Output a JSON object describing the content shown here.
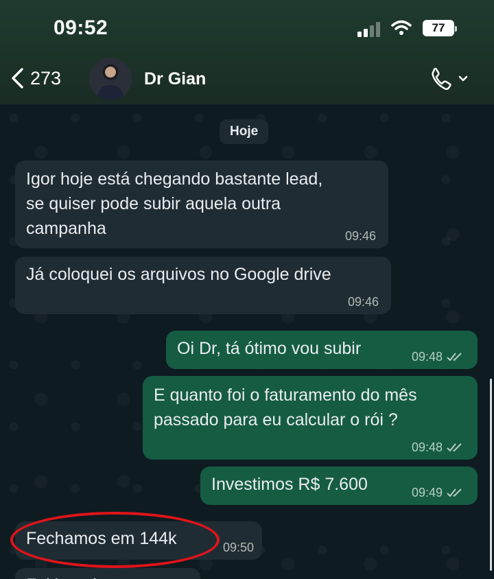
{
  "status_bar": {
    "time": "09:52",
    "battery": "77"
  },
  "header": {
    "back_count": "273",
    "contact_name": "Dr Gian"
  },
  "chat": {
    "day_label": "Hoje",
    "messages": [
      {
        "direction": "in",
        "text": "Igor hoje está chegando bastante lead, se quiser pode subir aquela outra campanha",
        "lines": [
          "Igor hoje está chegando bastante lead,",
          "se quiser pode subir aquela outra",
          "campanha"
        ],
        "time": "09:46"
      },
      {
        "direction": "in",
        "text": "Já coloquei os arquivos no Google drive",
        "time": "09:46"
      },
      {
        "direction": "out",
        "text": "Oi Dr, tá ótimo vou subir",
        "time": "09:48",
        "status": "read"
      },
      {
        "direction": "out",
        "text": "E quanto foi o faturamento do mês passado para eu calcular o rói ?",
        "lines": [
          "E quanto foi o faturamento do mês",
          "passado para eu calcular o rói ?"
        ],
        "time": "09:48",
        "status": "read"
      },
      {
        "direction": "out",
        "text": "Investimos R$ 7.600",
        "time": "09:49",
        "status": "read"
      },
      {
        "direction": "in",
        "text": "Fechamos em 144k",
        "time": "09:50",
        "highlighted": true
      },
      {
        "direction": "in",
        "text": "Foi bem bacana",
        "partially_visible": true
      }
    ]
  },
  "colors": {
    "header_bg": "#1c3328",
    "chat_bg": "#0e1b20",
    "incoming_bubble": "#202c33",
    "outgoing_bubble": "#155c43",
    "highlight_ring": "#e0141a"
  },
  "icons": [
    "back-chevron-icon",
    "signal-icon",
    "wifi-icon",
    "battery-icon",
    "phone-icon",
    "chevron-down-icon",
    "double-check-icon"
  ]
}
